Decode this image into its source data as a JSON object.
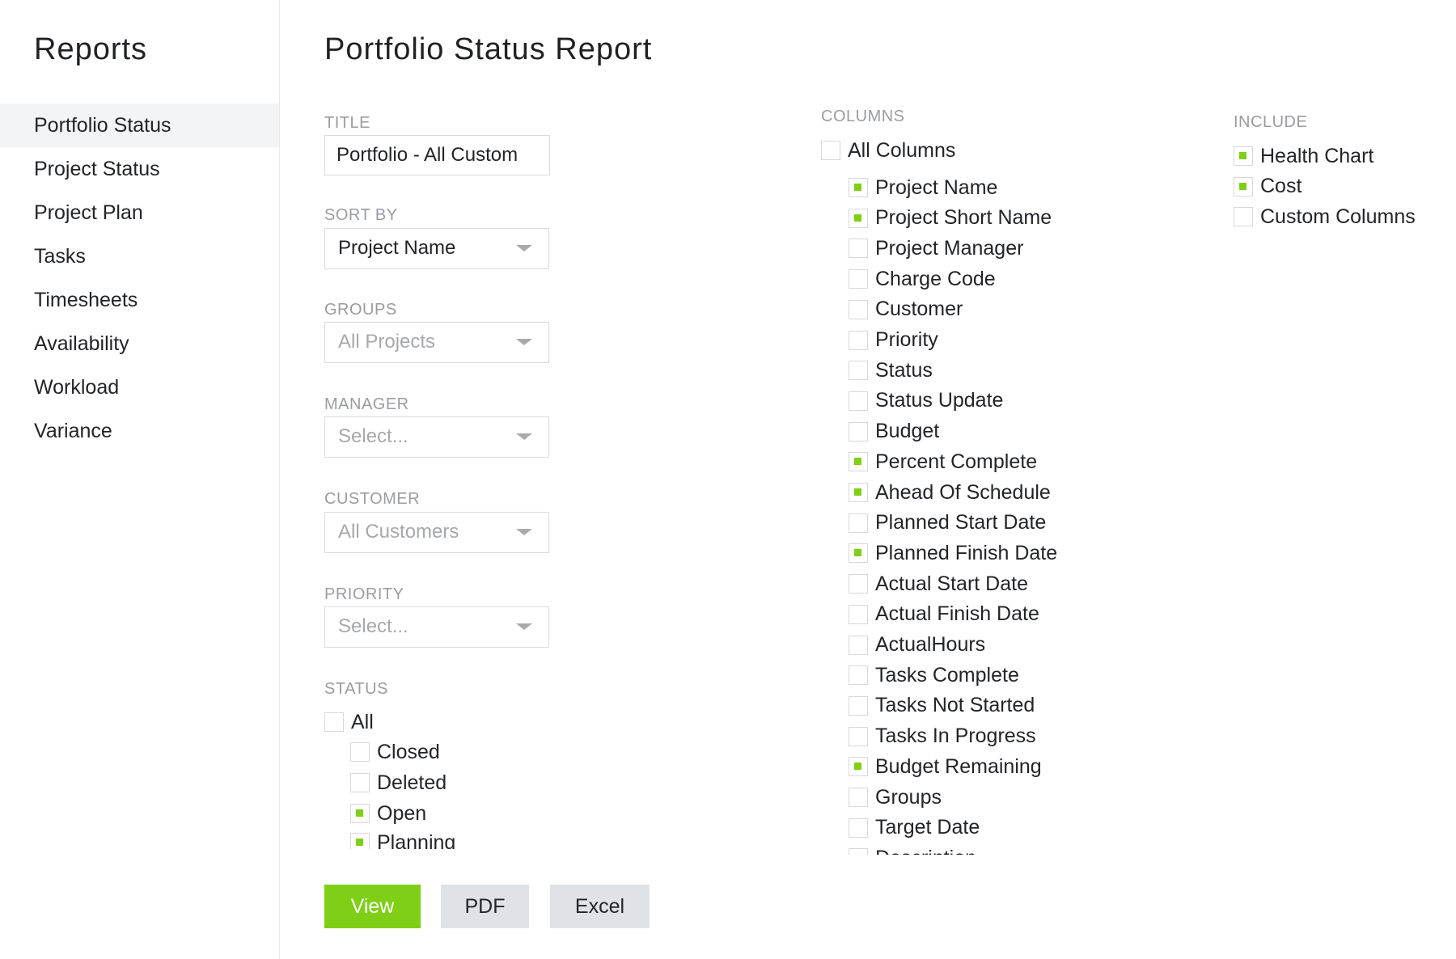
{
  "sidebar": {
    "title": "Reports",
    "items": [
      {
        "label": "Portfolio Status",
        "active": true
      },
      {
        "label": "Project Status"
      },
      {
        "label": "Project Plan"
      },
      {
        "label": "Tasks"
      },
      {
        "label": "Timesheets"
      },
      {
        "label": "Availability"
      },
      {
        "label": "Workload"
      },
      {
        "label": "Variance"
      }
    ]
  },
  "page": {
    "title": "Portfolio Status Report"
  },
  "form": {
    "title_label": "TITLE",
    "title_value": "Portfolio - All Custom",
    "sort_label": "SORT BY",
    "sort_value": "Project Name",
    "groups_label": "GROUPS",
    "groups_value": "All Projects",
    "manager_label": "MANAGER",
    "manager_value": "Select...",
    "customer_label": "CUSTOMER",
    "customer_value": "All Customers",
    "priority_label": "PRIORITY",
    "priority_value": "Select...",
    "status_label": "STATUS",
    "status_all": {
      "label": "All",
      "checked": false
    },
    "status_items": [
      {
        "label": "Closed",
        "checked": false
      },
      {
        "label": "Deleted",
        "checked": false
      },
      {
        "label": "Open",
        "checked": true
      },
      {
        "label": "Planning",
        "checked": true
      }
    ]
  },
  "columns": {
    "label": "COLUMNS",
    "all": {
      "label": "All Columns",
      "checked": false
    },
    "items": [
      {
        "label": "Project Name",
        "checked": true
      },
      {
        "label": "Project Short Name",
        "checked": true
      },
      {
        "label": "Project Manager",
        "checked": false
      },
      {
        "label": "Charge Code",
        "checked": false
      },
      {
        "label": "Customer",
        "checked": false
      },
      {
        "label": "Priority",
        "checked": false
      },
      {
        "label": "Status",
        "checked": false
      },
      {
        "label": "Status Update",
        "checked": false
      },
      {
        "label": "Budget",
        "checked": false
      },
      {
        "label": "Percent Complete",
        "checked": true
      },
      {
        "label": "Ahead Of Schedule",
        "checked": true
      },
      {
        "label": "Planned Start Date",
        "checked": false
      },
      {
        "label": "Planned Finish Date",
        "checked": true
      },
      {
        "label": "Actual Start Date",
        "checked": false
      },
      {
        "label": "Actual Finish Date",
        "checked": false
      },
      {
        "label": "ActualHours",
        "checked": false
      },
      {
        "label": "Tasks Complete",
        "checked": false
      },
      {
        "label": "Tasks Not Started",
        "checked": false
      },
      {
        "label": "Tasks In Progress",
        "checked": false
      },
      {
        "label": "Budget Remaining",
        "checked": true
      },
      {
        "label": "Groups",
        "checked": false
      },
      {
        "label": "Target Date",
        "checked": false
      },
      {
        "label": "Description",
        "checked": false
      }
    ]
  },
  "include": {
    "label": "INCLUDE",
    "items": [
      {
        "label": "Health Chart",
        "checked": true
      },
      {
        "label": "Cost",
        "checked": true
      },
      {
        "label": "Custom Columns",
        "checked": false
      }
    ]
  },
  "actions": {
    "view": "View",
    "pdf": "PDF",
    "excel": "Excel"
  },
  "colors": {
    "accent": "#7fcf16",
    "secondary_button": "#dfe2e6",
    "label_gray": "#9a9ca1"
  }
}
